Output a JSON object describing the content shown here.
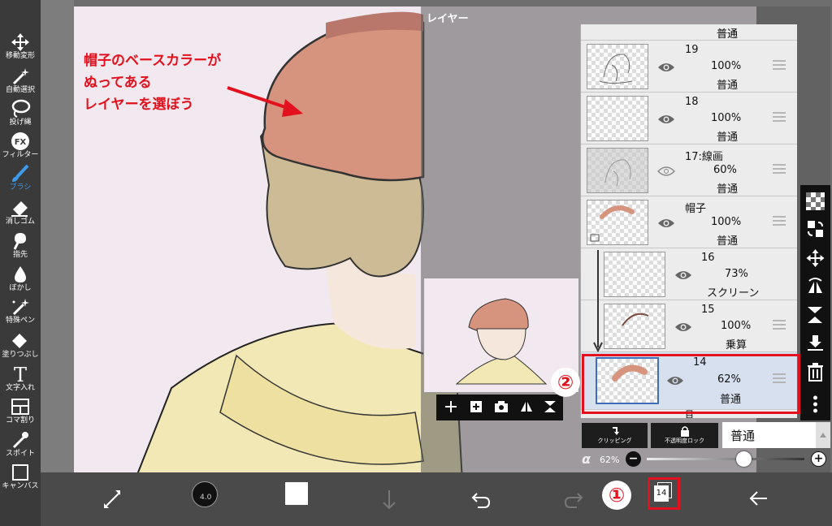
{
  "toolbar": {
    "tools": [
      {
        "label": "移動変形",
        "icon": "move-icon"
      },
      {
        "label": "自動選択",
        "icon": "magic-wand-icon"
      },
      {
        "label": "投げ縄",
        "icon": "lasso-icon"
      },
      {
        "label": "フィルター",
        "icon": "fx-icon",
        "glyph": "FX"
      },
      {
        "label": "ブラシ",
        "icon": "brush-icon",
        "active": true
      },
      {
        "label": "消しゴム",
        "icon": "eraser-icon"
      },
      {
        "label": "指先",
        "icon": "finger-icon"
      },
      {
        "label": "ぼかし",
        "icon": "blur-drop-icon"
      },
      {
        "label": "特殊ペン",
        "icon": "special-pen-icon"
      },
      {
        "label": "塗りつぶし",
        "icon": "fill-bucket-icon"
      },
      {
        "label": "文字入れ",
        "icon": "text-icon",
        "glyph": "T"
      },
      {
        "label": "コマ割り",
        "icon": "frame-divider-icon"
      },
      {
        "label": "スポイト",
        "icon": "eyedropper-icon"
      },
      {
        "label": "キャンバス",
        "icon": "canvas-icon"
      }
    ],
    "active_color": "#3d9be9"
  },
  "annotation": {
    "lines": [
      "帽子のベースカラーが",
      "ぬってある",
      "レイヤーを選ぼう"
    ],
    "color": "#e3101d"
  },
  "layer_panel": {
    "title": "レイヤー",
    "top_partial": "普通",
    "layers": [
      {
        "name": "19",
        "opacity": "100%",
        "blend": "普通",
        "thumb": "sketch"
      },
      {
        "name": "18",
        "opacity": "100%",
        "blend": "普通",
        "thumb": "empty"
      },
      {
        "name": "17:線画",
        "opacity": "60%",
        "blend": "普通",
        "thumb": "lineart"
      },
      {
        "name": "帽子",
        "opacity": "100%",
        "blend": "普通",
        "thumb": "hat-folder"
      },
      {
        "name": "16",
        "opacity": "73%",
        "blend": "スクリーン",
        "thumb": "empty",
        "clipped": true
      },
      {
        "name": "15",
        "opacity": "100%",
        "blend": "乗算",
        "thumb": "brown",
        "clipped": true
      },
      {
        "name": "14",
        "opacity": "62%",
        "blend": "普通",
        "thumb": "hat",
        "selected": true
      },
      {
        "name": "",
        "opacity": "",
        "blend": "目",
        "thumb": "empty"
      }
    ],
    "step_markers": [
      "①",
      "②"
    ],
    "clipping_label": "クリッピング",
    "alpha_lock_label": "不透明度ロック",
    "blend_mode": "普通",
    "alpha_symbol": "α",
    "alpha_value": "62%",
    "alpha_fraction": 0.62,
    "minus": "−",
    "plus": "+"
  },
  "bottom_bar": {
    "brush_size": "4.0",
    "layer_count": "14"
  },
  "colors": {
    "highlight_red": "#e3101d",
    "selected_row": "#d7e0ef",
    "hat": "#d6937d"
  }
}
